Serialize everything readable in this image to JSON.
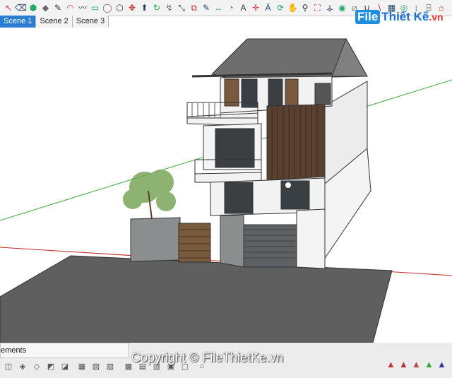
{
  "logo": {
    "part1": "File",
    "part2": "Thiết Kế",
    "part3": ".vn"
  },
  "tabs": [
    {
      "label": "Scene 1",
      "active": true
    },
    {
      "label": "Scene 2",
      "active": false
    },
    {
      "label": "Scene 3",
      "active": false
    }
  ],
  "toolbar_icons": [
    "select-icon",
    "eraser-icon",
    "paint-bucket-icon",
    "component-icon",
    "line-icon",
    "arc-icon",
    "freehand-icon",
    "rectangle-icon",
    "circle-icon",
    "polygon-icon",
    "move-icon",
    "push-pull-icon",
    "rotate-icon",
    "follow-me-icon",
    "scale-icon",
    "offset-icon",
    "tape-measure-icon",
    "dimension-icon",
    "protractor-icon",
    "text-icon",
    "axes-icon",
    "3d-text-icon",
    "orbit-icon",
    "pan-icon",
    "zoom-icon",
    "zoom-extents-icon",
    "walk-icon",
    "look-around-icon",
    "section-plane-icon",
    "solid-union-icon",
    "solid-subtract-icon",
    "sandbox-icon",
    "position-camera-icon",
    "dimension-tool-icon",
    "tag-icon",
    "warehouse-icon"
  ],
  "bottom_panel": {
    "label": "ements"
  },
  "copyright": "Copyright © FileThietKe.vn",
  "colors": {
    "accent": "#2b7cd3",
    "ground": "#5f5f5f",
    "roof": "#6e6e6e",
    "wall": "#f2f2f2",
    "stone": "#8a8e8f",
    "wood": "#7a5a3c",
    "green_axis": "#3caa3c",
    "red_axis": "#cc2222"
  }
}
